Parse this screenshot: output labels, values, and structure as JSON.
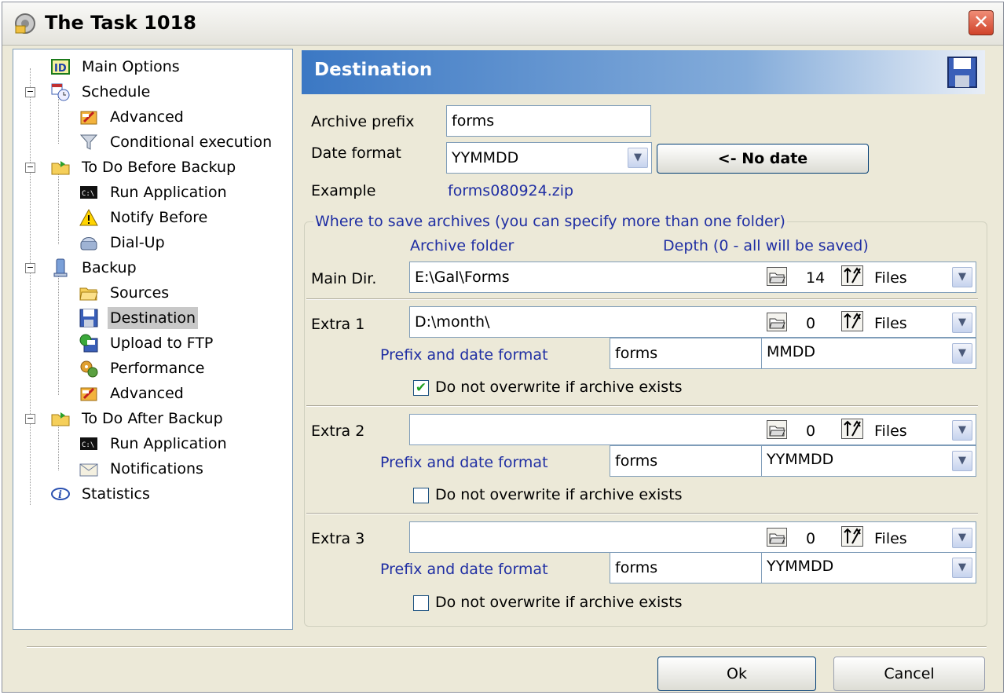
{
  "window": {
    "title": "The Task 1018",
    "close_glyph": "✕"
  },
  "tree": {
    "items": [
      {
        "label": "Main Options",
        "icon": "id-icon"
      },
      {
        "label": "Schedule",
        "icon": "calendar-clock-icon"
      },
      {
        "label": "Advanced",
        "icon": "advanced-tools-icon"
      },
      {
        "label": "Conditional execution",
        "icon": "filter-icon"
      },
      {
        "label": "To Do Before Backup",
        "icon": "folder-arrow-icon"
      },
      {
        "label": "Run Application",
        "icon": "console-icon"
      },
      {
        "label": "Notify Before",
        "icon": "warning-icon"
      },
      {
        "label": "Dial-Up",
        "icon": "dialup-icon"
      },
      {
        "label": "Backup",
        "icon": "computer-icon"
      },
      {
        "label": "Sources",
        "icon": "open-folder-icon"
      },
      {
        "label": "Destination",
        "icon": "floppy-disk-icon"
      },
      {
        "label": "Upload to FTP",
        "icon": "ftp-upload-icon"
      },
      {
        "label": "Performance",
        "icon": "performance-icon"
      },
      {
        "label": "Advanced",
        "icon": "advanced-tools-icon"
      },
      {
        "label": "To Do After Backup",
        "icon": "folder-arrow-icon"
      },
      {
        "label": "Run Application",
        "icon": "console-icon"
      },
      {
        "label": "Notifications",
        "icon": "envelope-icon"
      },
      {
        "label": "Statistics",
        "icon": "info-icon"
      }
    ],
    "selected": "Destination"
  },
  "header": {
    "title": "Destination"
  },
  "form": {
    "archive_prefix_label": "Archive prefix",
    "archive_prefix_value": "forms",
    "date_format_label": "Date format",
    "date_format_value": "YYMMDD",
    "no_date_button": "<- No date",
    "example_label": "Example",
    "example_value": "forms080924.zip"
  },
  "group": {
    "title": "Where to save archives (you can specify more than one folder)",
    "col_archive_folder": "Archive folder",
    "col_depth": "Depth (0 - all will be saved)",
    "prefix_date_label": "Prefix and date format",
    "overwrite_label": "Do not overwrite if archive exists",
    "main": {
      "label": "Main Dir.",
      "folder": "E:\\Gal\\Forms",
      "depth": "14",
      "unit": "Files"
    },
    "extras": [
      {
        "label": "Extra 1",
        "folder": "D:\\month\\",
        "depth": "0",
        "unit": "Files",
        "prefix": "forms",
        "date_format": "MMDD",
        "no_overwrite": true,
        "check_glyph": "✔"
      },
      {
        "label": "Extra 2",
        "folder": "",
        "depth": "0",
        "unit": "Files",
        "prefix": "forms",
        "date_format": "YYMMDD",
        "no_overwrite": false,
        "check_glyph": ""
      },
      {
        "label": "Extra 3",
        "folder": "",
        "depth": "0",
        "unit": "Files",
        "prefix": "forms",
        "date_format": "YYMMDD",
        "no_overwrite": false,
        "check_glyph": ""
      }
    ]
  },
  "buttons": {
    "ok": "Ok",
    "cancel": "Cancel"
  },
  "glyphs": {
    "dropdown": "▼"
  }
}
